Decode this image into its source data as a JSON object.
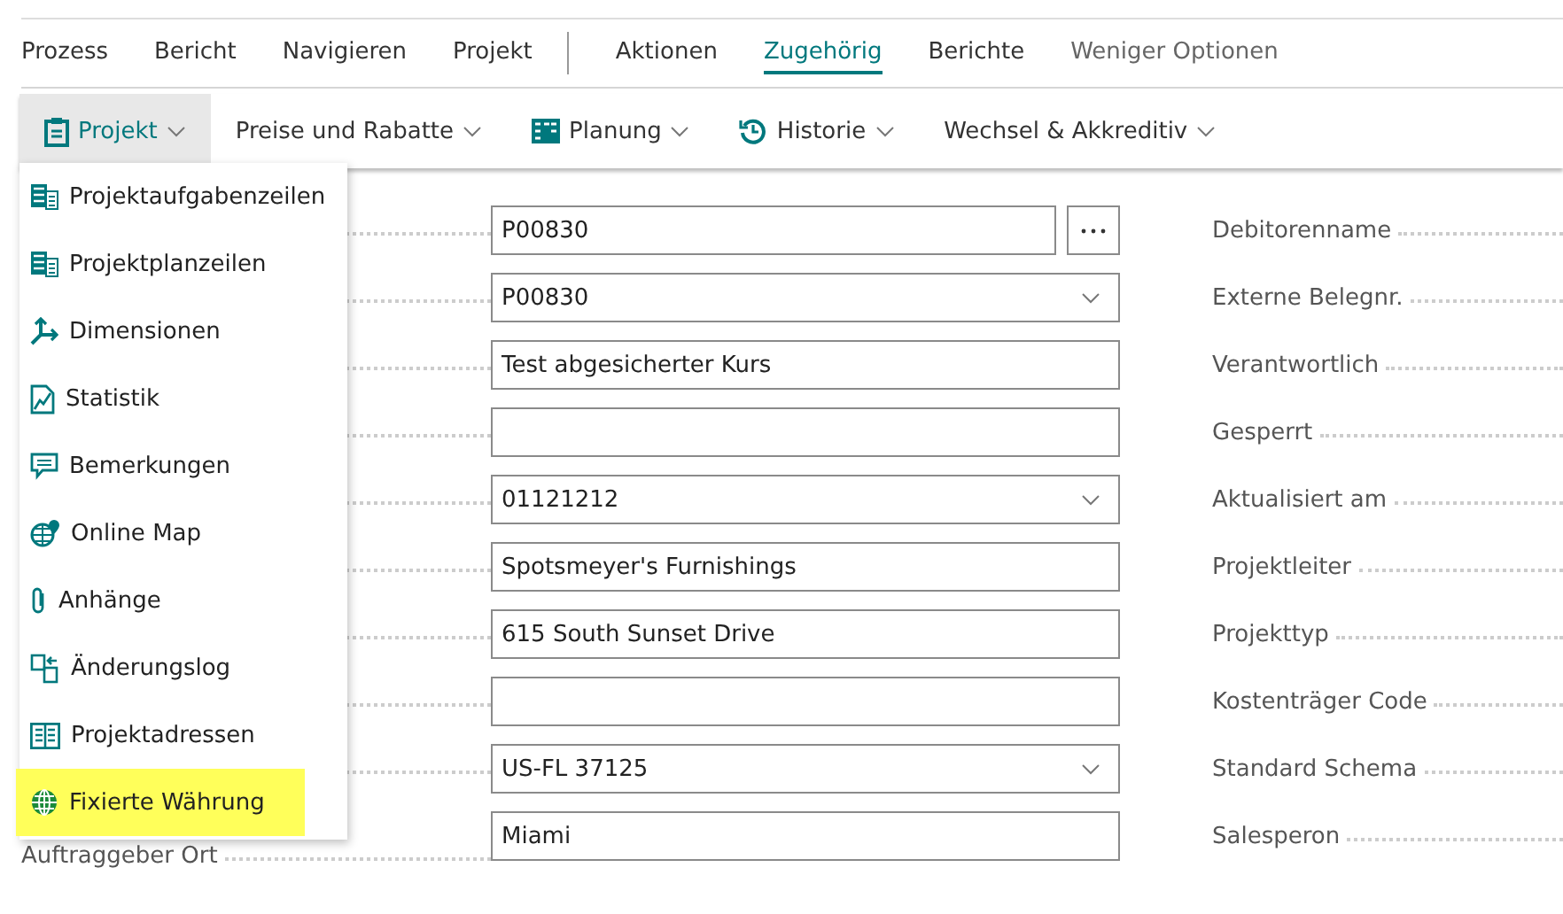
{
  "tabs": [
    {
      "label": "Prozess",
      "selected": false
    },
    {
      "label": "Bericht",
      "selected": false
    },
    {
      "label": "Navigieren",
      "selected": false
    },
    {
      "label": "Projekt",
      "selected": false
    },
    {
      "label": "Aktionen",
      "selected": false,
      "divider_before": true
    },
    {
      "label": "Zugehörig",
      "selected": true
    },
    {
      "label": "Berichte",
      "selected": false
    },
    {
      "label": "Weniger Optionen",
      "selected": false,
      "kind": "toggle"
    }
  ],
  "actions": [
    {
      "label": "Projekt",
      "expanded": true
    },
    {
      "label": "Preise und Rabatte",
      "expanded": false
    },
    {
      "label": "Planung",
      "expanded": false
    },
    {
      "label": "Historie",
      "expanded": false
    },
    {
      "label": "Wechsel & Akkreditiv",
      "expanded": false
    }
  ],
  "menu": [
    {
      "label": "Projektaufgabenzeilen",
      "highlighted": false
    },
    {
      "label": "Projektplanzeilen",
      "highlighted": false
    },
    {
      "label": "Dimensionen",
      "highlighted": false
    },
    {
      "label": "Statistik",
      "highlighted": false
    },
    {
      "label": "Bemerkungen",
      "highlighted": false
    },
    {
      "label": "Online Map",
      "highlighted": false
    },
    {
      "label": "Anhänge",
      "highlighted": false
    },
    {
      "label": "Änderungslog",
      "highlighted": false
    },
    {
      "label": "Projektadressen",
      "highlighted": false
    },
    {
      "label": "Fixierte Währung",
      "highlighted": true
    }
  ],
  "left_fields": [
    {
      "kind": "lookup",
      "value": "P00830"
    },
    {
      "kind": "dropdown",
      "value": "P00830"
    },
    {
      "kind": "text",
      "value": "Test abgesicherter Kurs"
    },
    {
      "kind": "text"
    },
    {
      "kind": "dropdown",
      "value": "01121212"
    },
    {
      "kind": "text",
      "value": "Spotsmeyer's Furnishings"
    },
    {
      "kind": "text",
      "value": "615 South Sunset Drive"
    },
    {
      "kind": "text"
    },
    {
      "kind": "dropdown",
      "value": "US-FL 37125"
    },
    {
      "kind": "text",
      "value": "Miami",
      "label": "Auftraggeber Ort"
    }
  ],
  "right_fields": [
    {
      "label": "Debitorenname"
    },
    {
      "label": "Externe Belegnr."
    },
    {
      "label": "Verantwortlich"
    },
    {
      "label": "Gesperrt"
    },
    {
      "label": "Aktualisiert am"
    },
    {
      "label": "Projektleiter"
    },
    {
      "label": "Projekttyp"
    },
    {
      "label": "Kostenträger Code"
    },
    {
      "label": "Standard Schema"
    },
    {
      "label": "Salesperon"
    }
  ]
}
